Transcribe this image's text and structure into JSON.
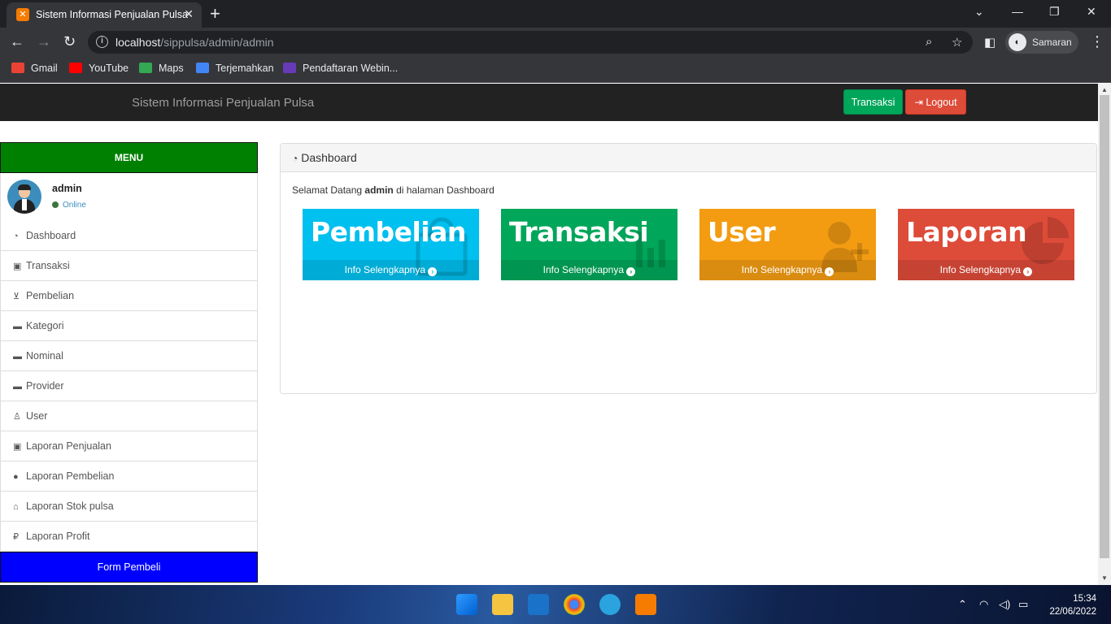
{
  "browser": {
    "tab_title": "Sistem Informasi Penjualan Pulsa",
    "url_host": "localhost",
    "url_path": "/sippulsa/admin/admin",
    "profile_name": "Samaran",
    "bookmarks": [
      "Gmail",
      "YouTube",
      "Maps",
      "Terjemahkan",
      "Pendaftaran Webin..."
    ]
  },
  "navbar": {
    "brand": "Sistem Informasi Penjualan Pulsa",
    "transaksi_label": "Transaksi",
    "logout_label": "Logout"
  },
  "sidebar": {
    "menu_header": "MENU",
    "user_name": "admin",
    "user_status": "Online",
    "items": [
      {
        "label": "Dashboard",
        "icon": "dashboard-icon"
      },
      {
        "label": "Transaksi",
        "icon": "money-icon"
      },
      {
        "label": "Pembelian",
        "icon": "cart-icon"
      },
      {
        "label": "Kategori",
        "icon": "folder-icon"
      },
      {
        "label": "Nominal",
        "icon": "folder-icon"
      },
      {
        "label": "Provider",
        "icon": "folder-icon"
      },
      {
        "label": "User",
        "icon": "user-icon"
      },
      {
        "label": "Laporan Penjualan",
        "icon": "money-icon"
      },
      {
        "label": "Laporan Pembelian",
        "icon": "circle-icon"
      },
      {
        "label": "Laporan Stok pulsa",
        "icon": "bank-icon"
      },
      {
        "label": "Laporan Profit",
        "icon": "ruble-icon"
      }
    ],
    "form_button": "Form Pembeli"
  },
  "panel": {
    "title": "Dashboard",
    "welcome_prefix": "Selamat Datang ",
    "welcome_user": "admin",
    "welcome_suffix": " di halaman Dashboard",
    "boxes": [
      {
        "title": "Pembelian",
        "link": "Info Selengkapnya",
        "color": "#00c0ef"
      },
      {
        "title": "Transaksi",
        "link": "Info Selengkapnya",
        "color": "#00a65a"
      },
      {
        "title": "User",
        "link": "Info Selengkapnya",
        "color": "#f39c12"
      },
      {
        "title": "Laporan",
        "link": "Info Selengkapnya",
        "color": "#dd4b39"
      }
    ]
  },
  "taskbar": {
    "time": "15:34",
    "date": "22/06/2022"
  }
}
